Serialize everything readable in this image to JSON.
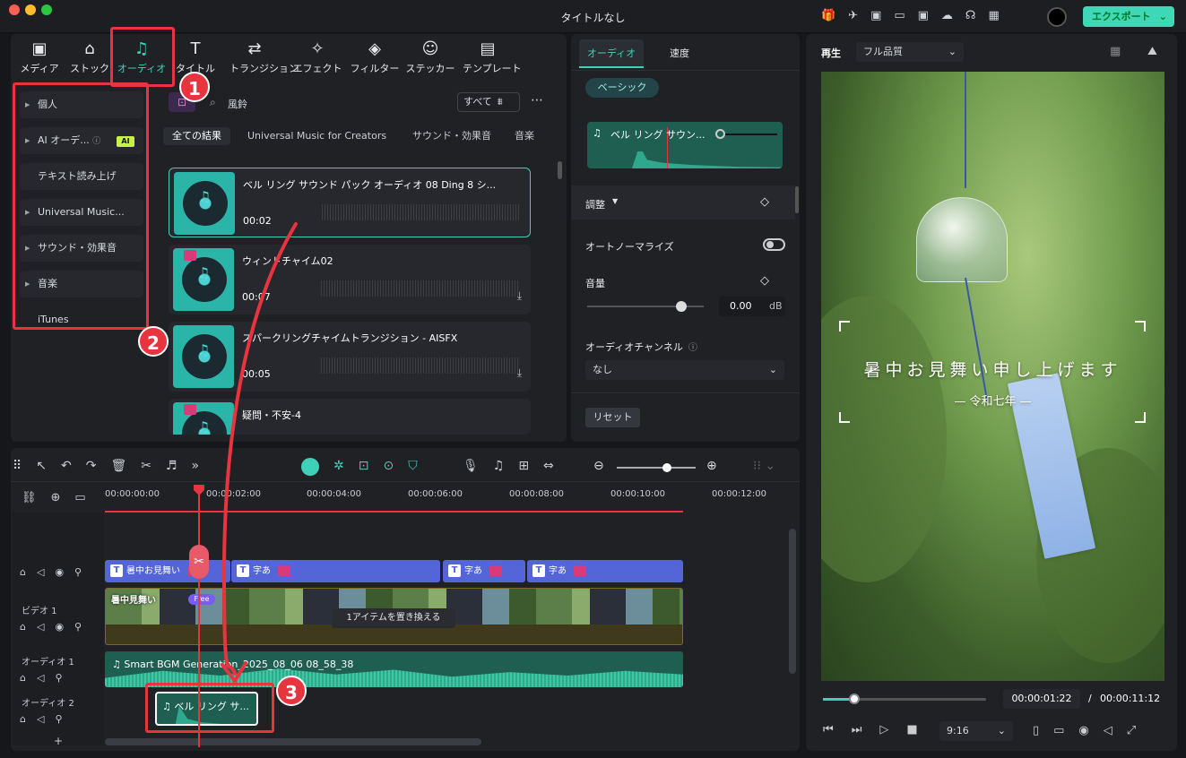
{
  "window": {
    "title": "タイトルなし",
    "export_label": "エクスポート"
  },
  "tabs": [
    {
      "label": "メディア",
      "icon": "media-icon"
    },
    {
      "label": "ストック",
      "icon": "stock-icon"
    },
    {
      "label": "オーディオ",
      "icon": "audio-icon"
    },
    {
      "label": "タイトル",
      "icon": "title-icon"
    },
    {
      "label": "トランジション",
      "icon": "transition-icon"
    },
    {
      "label": "エフェクト",
      "icon": "effect-icon"
    },
    {
      "label": "フィルター",
      "icon": "filter-icon"
    },
    {
      "label": "ステッカー",
      "icon": "sticker-icon"
    },
    {
      "label": "テンプレート",
      "icon": "template-icon"
    }
  ],
  "sidebar": {
    "items": [
      "個人",
      "AI オーデ...",
      "テキスト読み上げ",
      "Universal Music...",
      "サウンド・効果音",
      "音楽",
      "iTunes"
    ],
    "ai_badge": "AI"
  },
  "search": {
    "query": "風鈴",
    "filter_label": "すべて"
  },
  "result_tabs": [
    "全ての結果",
    "Universal Music for Creators",
    "サウンド・効果音",
    "音楽"
  ],
  "results": [
    {
      "title": "ベル リング サウンド パック オーディオ 08 Ding 8 シ...",
      "time": "00:02"
    },
    {
      "title": "ウィンドチャイム02",
      "time": "00:07"
    },
    {
      "title": "スパークリングチャイムトランジション - AISFX",
      "time": "00:05"
    },
    {
      "title": "疑問・不安-4",
      "time": ""
    }
  ],
  "props": {
    "tabs": [
      "オーディオ",
      "速度"
    ],
    "basic_label": "ベーシック",
    "clip_name": "ベル リング サウン...",
    "adjust_label": "調整",
    "auto_normalize": "オートノーマライズ",
    "volume_label": "音量",
    "volume_value": "0.00",
    "volume_unit": "dB",
    "channel_label": "オーディオチャンネル",
    "channel_value": "なし",
    "reset_label": "リセット"
  },
  "preview": {
    "play_label": "再生",
    "quality": "フル品質",
    "main_text": "暑中お見舞い申し上げます",
    "sub_text": "— 令和七年 —",
    "current_time": "00:00:01:22",
    "total_time": "00:00:11:12",
    "time_sep": "/",
    "ratio": "9:16",
    "progress": 0.19
  },
  "timeline": {
    "ticks": [
      "00:00:00:00",
      "00:00:02:00",
      "00:00:04:00",
      "00:00:06:00",
      "00:00:08:00",
      "00:00:10:00",
      "00:00:12:00"
    ],
    "title_clips": [
      "暑中お見舞い",
      "字あ",
      "字あ",
      "字あ"
    ],
    "video_label": "ビデオ 1",
    "video_clip": "暑中見舞い",
    "free_badge": "Free",
    "replace_tip": "1アイテムを置き換える",
    "audio1_label": "オーディオ 1",
    "audio1_clip": "Smart BGM Generation_2025_08_06 08_58_38",
    "audio2_label": "オーディオ 2",
    "audio2_clip": "ベル リング サ...",
    "add_label": "+"
  },
  "annotations": [
    "1",
    "2",
    "3"
  ],
  "colors": {
    "accent": "#3fd1b8",
    "red": "#e8343f",
    "title_clip": "#5465d8",
    "audio_clip": "#2fa98c"
  }
}
